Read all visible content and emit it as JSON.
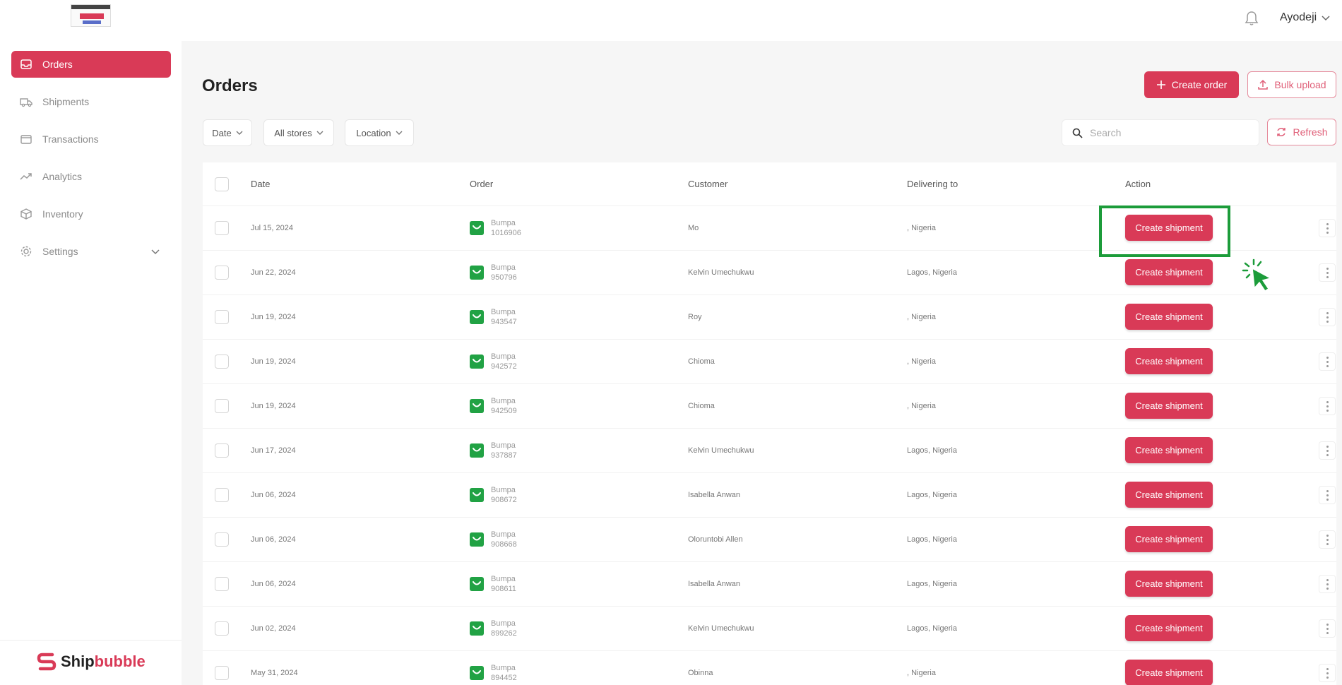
{
  "header": {
    "user_name": "Ayodeji"
  },
  "sidebar": {
    "items": [
      {
        "label": "Orders",
        "icon": "inbox-icon",
        "active": true
      },
      {
        "label": "Shipments",
        "icon": "truck-icon"
      },
      {
        "label": "Transactions",
        "icon": "wallet-icon"
      },
      {
        "label": "Analytics",
        "icon": "trend-icon"
      },
      {
        "label": "Inventory",
        "icon": "box-icon"
      },
      {
        "label": "Settings",
        "icon": "gear-icon"
      }
    ],
    "brand": {
      "part1": "Ship",
      "part2": "bubble"
    }
  },
  "page": {
    "title": "Orders",
    "create_order_label": "Create order",
    "bulk_upload_label": "Bulk upload",
    "refresh_label": "Refresh",
    "search_placeholder": "Search",
    "filters": {
      "date": "Date",
      "stores": "All stores",
      "location": "Location"
    }
  },
  "table": {
    "headers": {
      "date": "Date",
      "order": "Order",
      "customer": "Customer",
      "delivering_to": "Delivering to",
      "action": "Action"
    },
    "action_label": "Create shipment",
    "rows": [
      {
        "date": "Jul 15, 2024",
        "store": "Bumpa",
        "order_id": "1016906",
        "customer": "Mo",
        "delivering_to": ", Nigeria"
      },
      {
        "date": "Jun 22, 2024",
        "store": "Bumpa",
        "order_id": "950796",
        "customer": "Kelvin Umechukwu",
        "delivering_to": "Lagos, Nigeria"
      },
      {
        "date": "Jun 19, 2024",
        "store": "Bumpa",
        "order_id": "943547",
        "customer": "Roy",
        "delivering_to": ", Nigeria"
      },
      {
        "date": "Jun 19, 2024",
        "store": "Bumpa",
        "order_id": "942572",
        "customer": "Chioma",
        "delivering_to": ", Nigeria"
      },
      {
        "date": "Jun 19, 2024",
        "store": "Bumpa",
        "order_id": "942509",
        "customer": "Chioma",
        "delivering_to": ", Nigeria"
      },
      {
        "date": "Jun 17, 2024",
        "store": "Bumpa",
        "order_id": "937887",
        "customer": "Kelvin Umechukwu",
        "delivering_to": "Lagos, Nigeria"
      },
      {
        "date": "Jun 06, 2024",
        "store": "Bumpa",
        "order_id": "908672",
        "customer": "Isabella Anwan",
        "delivering_to": "Lagos, Nigeria"
      },
      {
        "date": "Jun 06, 2024",
        "store": "Bumpa",
        "order_id": "908668",
        "customer": "Oloruntobi Allen",
        "delivering_to": "Lagos, Nigeria"
      },
      {
        "date": "Jun 06, 2024",
        "store": "Bumpa",
        "order_id": "908611",
        "customer": "Isabella Anwan",
        "delivering_to": "Lagos, Nigeria"
      },
      {
        "date": "Jun 02, 2024",
        "store": "Bumpa",
        "order_id": "899262",
        "customer": "Kelvin Umechukwu",
        "delivering_to": "Lagos, Nigeria"
      },
      {
        "date": "May 31, 2024",
        "store": "Bumpa",
        "order_id": "894452",
        "customer": "Obinna",
        "delivering_to": ", Nigeria"
      }
    ]
  },
  "colors": {
    "accent": "#d93a57",
    "highlight": "#1c9c3a",
    "store_badge": "#21a244"
  }
}
